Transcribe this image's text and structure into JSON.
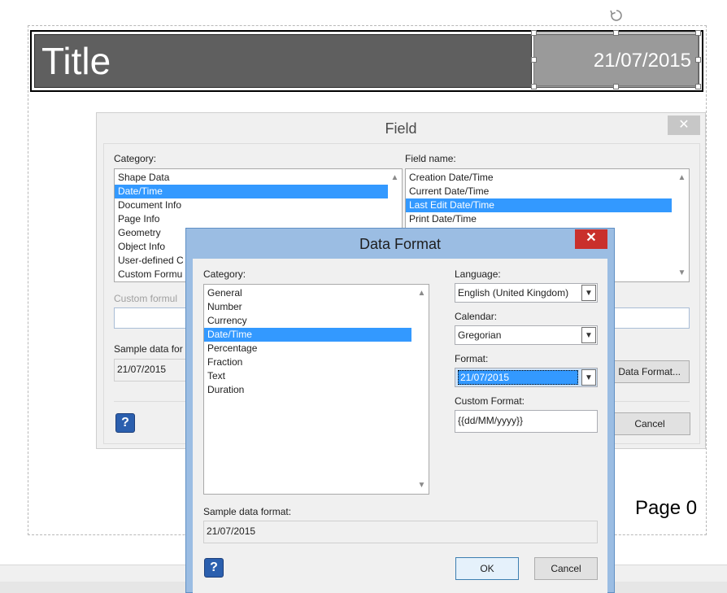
{
  "slide": {
    "title": "Title",
    "date": "21/07/2015",
    "page_label": "Page 0"
  },
  "field_dialog": {
    "title": "Field",
    "close_glyph": "✕",
    "category_label": "Category:",
    "categories": [
      "Shape Data",
      "Date/Time",
      "Document Info",
      "Page Info",
      "Geometry",
      "Object Info",
      "User-defined C",
      "Custom Formu"
    ],
    "selected_category": "Date/Time",
    "field_name_label": "Field name:",
    "field_names": [
      "Creation Date/Time",
      "Current Date/Time",
      "Last Edit Date/Time",
      "Print Date/Time"
    ],
    "selected_field_name": "Last Edit Date/Time",
    "custom_formula_label": "Custom formul",
    "sample_label": "Sample data for",
    "sample_value": "21/07/2015",
    "data_format_button": "Data Format...",
    "cancel_button": "Cancel",
    "help_glyph": "?"
  },
  "data_format_dialog": {
    "title": "Data Format",
    "close_glyph": "✕",
    "category_label": "Category:",
    "categories": [
      "General",
      "Number",
      "Currency",
      "Date/Time",
      "Percentage",
      "Fraction",
      "Text",
      "Duration"
    ],
    "selected_category": "Date/Time",
    "language_label": "Language:",
    "language_value": "English (United Kingdom)",
    "calendar_label": "Calendar:",
    "calendar_value": "Gregorian",
    "format_label": "Format:",
    "format_value": "21/07/2015",
    "custom_format_label": "Custom Format:",
    "custom_format_value": "{{dd/MM/yyyy}}",
    "sample_label": "Sample data format:",
    "sample_value": "21/07/2015",
    "ok_button": "OK",
    "cancel_button": "Cancel",
    "help_glyph": "?"
  },
  "icons": {
    "rotate": "rotate-handle-icon",
    "help": "help-icon",
    "close": "close-icon",
    "dropdown": "chevron-down-icon",
    "scroll_up": "scroll-up-arrow-icon",
    "scroll_down": "scroll-down-arrow-icon"
  },
  "colors": {
    "selection": "#3399ff",
    "title_bar": "#5f5f5f",
    "date_box": "#9a9a9a",
    "dialog_frame": "#9bbde3",
    "close_red": "#c9302c"
  }
}
